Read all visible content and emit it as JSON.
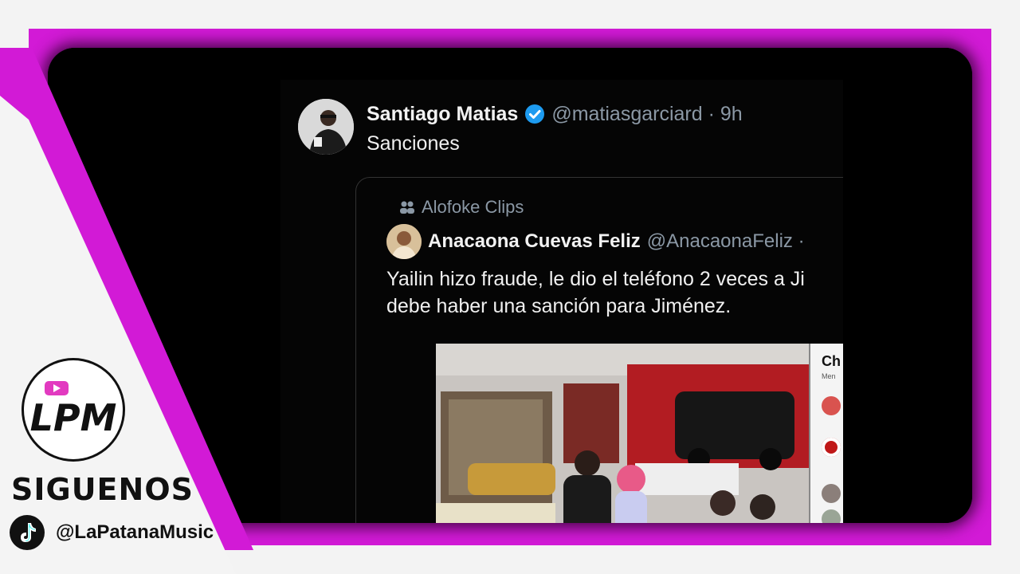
{
  "overlay": {
    "follow_label": "SIGUENOS",
    "tiktok_handle": "@LaPatanaMusic",
    "brand_logo_text": "LPM",
    "accent_color": "#d21ad6"
  },
  "tweet": {
    "author_name": "Santiago Matias",
    "handle_time": "@matiasgarciard · 9h",
    "text": "Sanciones",
    "verified": true
  },
  "quoted_tweet": {
    "community": "Alofoke Clips",
    "author_name": "Anacaona Cuevas Feliz",
    "handle": "@AnacaonaFeliz ·",
    "text_line1": "Yailin hizo fraude, le dio el teléfono 2 veces a Ji",
    "text_line2": "debe haber una sanción para Jiménez.",
    "media_chat_title": "Ch",
    "media_chat_sub": "Men"
  },
  "colors": {
    "background": "#000000",
    "text_primary": "#f0f0f0",
    "text_secondary": "#8b98a5",
    "verified_blue": "#1d9bf0"
  }
}
